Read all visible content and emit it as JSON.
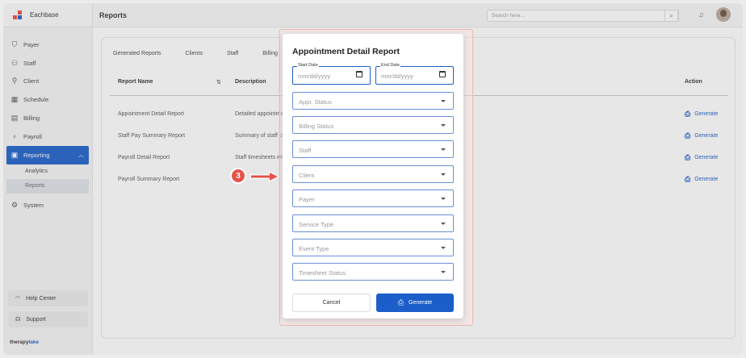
{
  "brand": {
    "name": "Eachbase"
  },
  "header": {
    "title": "Reports",
    "search_placeholder": "Search here..."
  },
  "sidebar": {
    "items": [
      {
        "label": "Payer",
        "icon": "shield-icon"
      },
      {
        "label": "Staff",
        "icon": "people-icon"
      },
      {
        "label": "Client",
        "icon": "person-icon"
      },
      {
        "label": "Schedule",
        "icon": "calendar-icon"
      },
      {
        "label": "Billing",
        "icon": "receipt-icon"
      },
      {
        "label": "Payroll",
        "icon": "payroll-icon"
      },
      {
        "label": "Reporting",
        "icon": "report-icon"
      },
      {
        "label": "System",
        "icon": "gear-icon"
      }
    ],
    "sub_items": [
      {
        "label": "Analytics"
      },
      {
        "label": "Reports"
      }
    ],
    "help_label": "Help Center",
    "support_label": "Support",
    "footer_a": "therapy",
    "footer_b": "lake"
  },
  "tabs": [
    "Generated Reports",
    "Clients",
    "Staff",
    "Billing"
  ],
  "table": {
    "headers": {
      "name": "Report Name",
      "description": "Description",
      "action": "Action"
    },
    "rows": [
      {
        "name": "Appointment Detail Report",
        "description": "Detailed appointmer",
        "action": "Generate"
      },
      {
        "name": "Staff Pay Summary Report",
        "description": "Summary of staff pa",
        "action": "Generate"
      },
      {
        "name": "Payroll Detail Report",
        "description": "Staff timesheets wit",
        "action": "Generate"
      },
      {
        "name": "Payroll Summary Report",
        "description": "",
        "action": "Generate"
      }
    ]
  },
  "modal": {
    "title": "Appointment Detail Report",
    "start_date": {
      "label": "Start Date",
      "placeholder": "mm/dd/yyyy"
    },
    "end_date": {
      "label": "End Date",
      "placeholder": "mm/dd/yyyy"
    },
    "selects": [
      "Appt. Status",
      "Billing Status",
      "Staff",
      "Client",
      "Payer",
      "Service Type",
      "Event Type",
      "Timesheet Status"
    ],
    "cancel_label": "Cancel",
    "generate_label": "Generate"
  },
  "annotation": {
    "step": "3",
    "color": "#e5524a"
  },
  "colors": {
    "accent": "#1c5ec9"
  }
}
